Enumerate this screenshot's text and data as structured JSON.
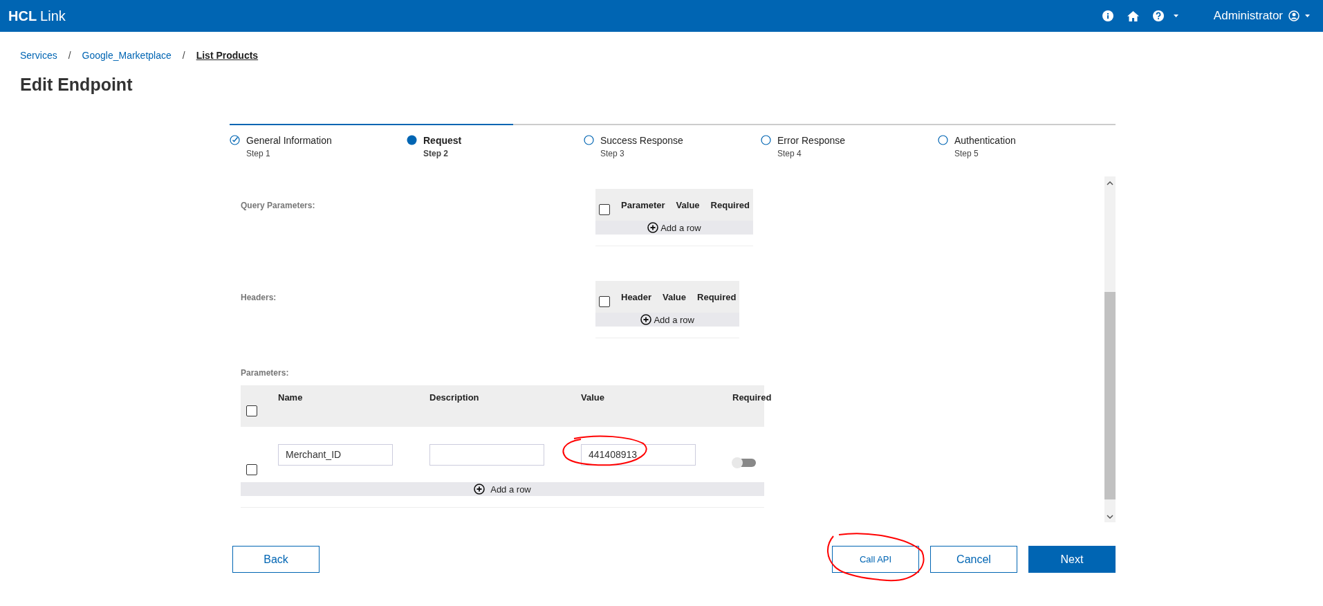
{
  "app": {
    "brand_bold": "HCL",
    "brand_light": "Link",
    "user": "Administrator"
  },
  "breadcrumb": [
    {
      "label": "Services",
      "current": false
    },
    {
      "label": "Google_Marketplace",
      "current": false
    },
    {
      "label": "List Products",
      "current": true
    }
  ],
  "breadcrumb_separator": "/",
  "title": "Edit Endpoint",
  "steps": [
    {
      "label": "General Information",
      "sub": "Step 1",
      "completed": true,
      "selected": false
    },
    {
      "label": "Request",
      "sub": "Step 2",
      "completed": false,
      "selected": true
    },
    {
      "label": "Success Response",
      "sub": "Step 3",
      "completed": false,
      "selected": false
    },
    {
      "label": "Error Response",
      "sub": "Step 4",
      "completed": false,
      "selected": false
    },
    {
      "label": "Authentication",
      "sub": "Step 5",
      "completed": false,
      "selected": false
    }
  ],
  "query_parameters": {
    "label": "Query Parameters:",
    "columns": [
      "Parameter",
      "Value",
      "Required"
    ],
    "add_row": "Add a row",
    "checked": false
  },
  "headers": {
    "label": "Headers:",
    "columns": [
      "Header",
      "Value",
      "Required"
    ],
    "add_row": "Add a row",
    "checked": false
  },
  "parameters": {
    "label": "Parameters:",
    "columns": [
      "Name",
      "Description",
      "Value",
      "Required"
    ],
    "checked": false,
    "add_row": "Add a row",
    "rows": [
      {
        "checked": false,
        "name": "Merchant_ID",
        "value": "441408913",
        "required": false
      }
    ]
  },
  "buttons": [
    {
      "label": "Back",
      "kind": "outline"
    },
    {
      "label": "Call API",
      "kind": "outline-small"
    },
    {
      "label": "Cancel",
      "kind": "outline"
    },
    {
      "label": "Next",
      "kind": "primary"
    }
  ]
}
